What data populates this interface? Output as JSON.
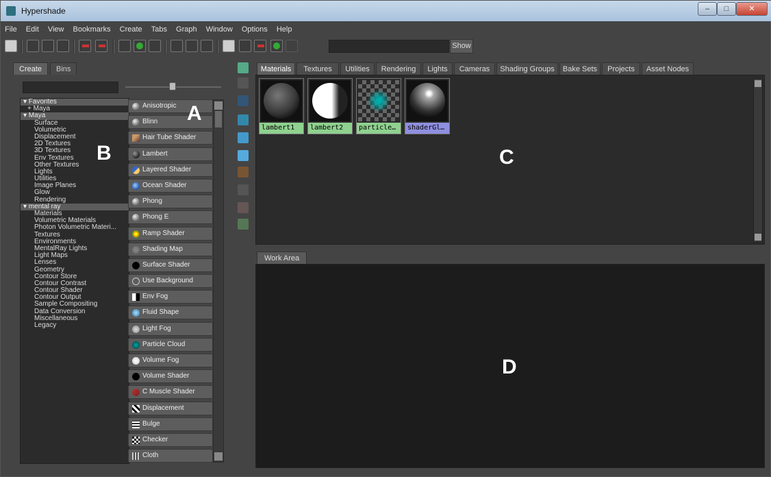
{
  "window": {
    "title": "Hypershade"
  },
  "menu": [
    "File",
    "Edit",
    "View",
    "Bookmarks",
    "Create",
    "Tabs",
    "Graph",
    "Window",
    "Options",
    "Help"
  ],
  "toolbar": {
    "show_label": "Show",
    "search_value": ""
  },
  "left_panel": {
    "tabs": [
      "Create",
      "Bins"
    ],
    "tree": [
      {
        "label": "▾ Favorites",
        "kind": "header"
      },
      {
        "label": "+ Maya",
        "kind": "plus"
      },
      {
        "label": "▾ Maya",
        "kind": "header"
      },
      {
        "label": "Surface",
        "kind": "child"
      },
      {
        "label": "Volumetric",
        "kind": "child"
      },
      {
        "label": "Displacement",
        "kind": "child"
      },
      {
        "label": "2D Textures",
        "kind": "child"
      },
      {
        "label": "3D Textures",
        "kind": "child"
      },
      {
        "label": "Env Textures",
        "kind": "child"
      },
      {
        "label": "Other Textures",
        "kind": "child"
      },
      {
        "label": "Lights",
        "kind": "child"
      },
      {
        "label": "Utilities",
        "kind": "child"
      },
      {
        "label": "Image Planes",
        "kind": "child"
      },
      {
        "label": "Glow",
        "kind": "child"
      },
      {
        "label": "Rendering",
        "kind": "child"
      },
      {
        "label": "▾ mental ray",
        "kind": "header"
      },
      {
        "label": "Materials",
        "kind": "child"
      },
      {
        "label": "Volumetric Materials",
        "kind": "child"
      },
      {
        "label": "Photon Volumetric Materi...",
        "kind": "child"
      },
      {
        "label": "Textures",
        "kind": "child"
      },
      {
        "label": "Environments",
        "kind": "child"
      },
      {
        "label": "MentalRay Lights",
        "kind": "child"
      },
      {
        "label": "Light Maps",
        "kind": "child"
      },
      {
        "label": "Lenses",
        "kind": "child"
      },
      {
        "label": "Geometry",
        "kind": "child"
      },
      {
        "label": "Contour Store",
        "kind": "child"
      },
      {
        "label": "Contour Contrast",
        "kind": "child"
      },
      {
        "label": "Contour Shader",
        "kind": "child"
      },
      {
        "label": "Contour Output",
        "kind": "child"
      },
      {
        "label": "Sample Compositing",
        "kind": "child"
      },
      {
        "label": "Data Conversion",
        "kind": "child"
      },
      {
        "label": "Miscellaneous",
        "kind": "child"
      },
      {
        "label": "Legacy",
        "kind": "child"
      }
    ],
    "nodes": [
      {
        "label": "Anisotropic",
        "icon": "sphere-gray"
      },
      {
        "label": "Blinn",
        "icon": "sphere-gray"
      },
      {
        "label": "Hair Tube Shader",
        "icon": "hair-tube"
      },
      {
        "label": "Lambert",
        "icon": "sphere-dark"
      },
      {
        "label": "Layered Shader",
        "icon": "layered"
      },
      {
        "label": "Ocean Shader",
        "icon": "ocean"
      },
      {
        "label": "Phong",
        "icon": "sphere-gray"
      },
      {
        "label": "Phong E",
        "icon": "sphere-gray"
      },
      {
        "label": "Ramp Shader",
        "icon": "ramp"
      },
      {
        "label": "Shading Map",
        "icon": "shading-map"
      },
      {
        "label": "Surface Shader",
        "icon": "black-circle"
      },
      {
        "label": "Use Background",
        "icon": "outline-circle"
      },
      {
        "label": "Env Fog",
        "icon": "env-fog"
      },
      {
        "label": "Fluid Shape",
        "icon": "fluid"
      },
      {
        "label": "Light Fog",
        "icon": "light-fog"
      },
      {
        "label": "Particle Cloud",
        "icon": "particle-cloud"
      },
      {
        "label": "Volume Fog",
        "icon": "volume-fog"
      },
      {
        "label": "Volume Shader",
        "icon": "black-circle"
      },
      {
        "label": "C Muscle Shader",
        "icon": "muscle"
      },
      {
        "label": "Displacement",
        "icon": "displacement"
      },
      {
        "label": "Bulge",
        "icon": "bulge"
      },
      {
        "label": "Checker",
        "icon": "checker"
      },
      {
        "label": "Cloth",
        "icon": "cloth"
      }
    ]
  },
  "right_panel": {
    "tabs": [
      "Materials",
      "Textures",
      "Utilities",
      "Rendering",
      "Lights",
      "Cameras",
      "Shading Groups",
      "Bake Sets",
      "Projects",
      "Asset Nodes"
    ],
    "active_tab": "Materials",
    "materials": [
      {
        "label": "lambert1",
        "label_color": "#8fd18f",
        "kind": "dark-sphere"
      },
      {
        "label": "lambert2",
        "label_color": "#8fd18f",
        "kind": "white-sphere"
      },
      {
        "label": "particle…",
        "label_color": "#8fd18f",
        "kind": "particle"
      },
      {
        "label": "shaderGl…",
        "label_color": "#8f8fe0",
        "kind": "glossy-sphere"
      }
    ],
    "work_area_tab": "Work Area"
  },
  "overlay_letters": {
    "a": "A",
    "b": "B",
    "c": "C",
    "d": "D"
  }
}
